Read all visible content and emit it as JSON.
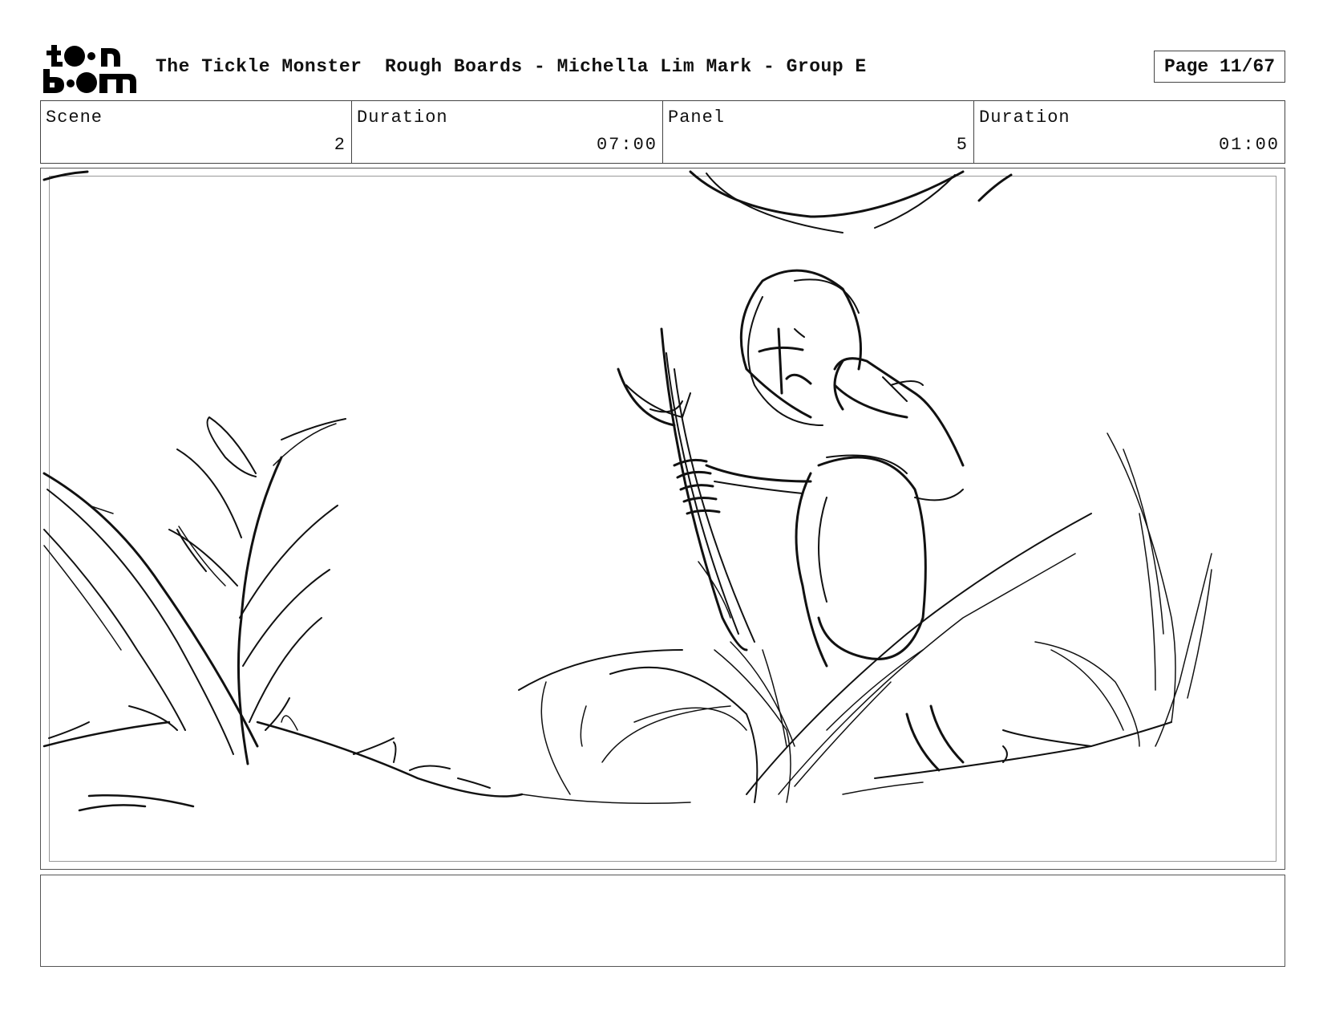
{
  "header": {
    "logo_text": "toon boom",
    "title": "The Tickle Monster  Rough Boards - Michella Lim Mark - Group E",
    "page": "Page 11/67"
  },
  "info": {
    "scene_label": "Scene",
    "scene_value": "2",
    "scene_duration_label": "Duration",
    "scene_duration_value": "07:00",
    "panel_label": "Panel",
    "panel_value": "5",
    "panel_duration_label": "Duration",
    "panel_duration_value": "01:00"
  },
  "notes": {
    "text": ""
  }
}
